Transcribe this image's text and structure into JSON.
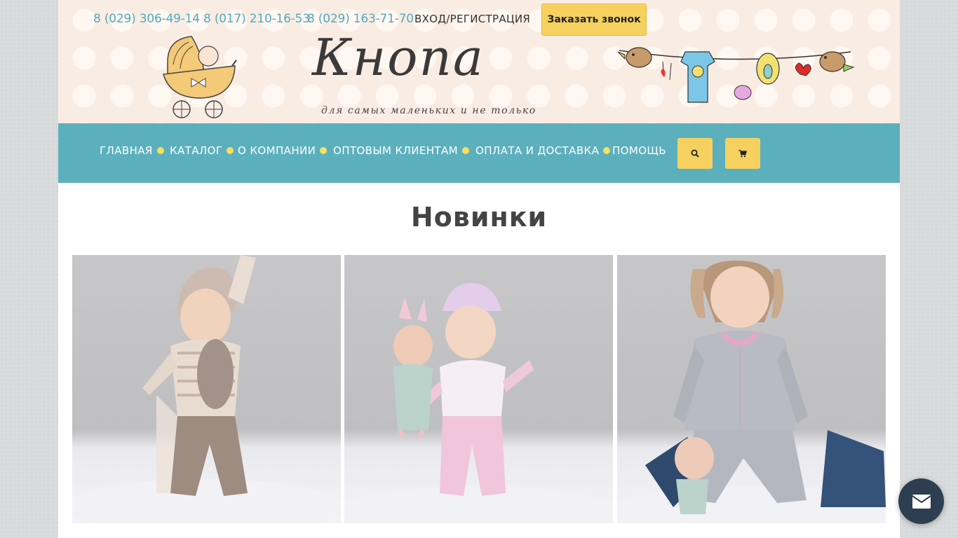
{
  "header": {
    "phones": [
      "8 (029) 306-49-14",
      "8 (017) 210-16-53",
      "8 (029) 163-71-70"
    ],
    "login_label": "ВХОД/РЕГИСТРАЦИЯ",
    "callback_label": "Заказать звонок",
    "logo_text": "Кнопа",
    "logo_tagline": "для самых маленьких и не только"
  },
  "nav": {
    "items": [
      "ГЛАВНАЯ",
      "КАТАЛОГ",
      "О КОМПАНИИ",
      "ОПТОВЫМ КЛИЕНТАМ",
      "ОПЛАТА И ДОСТАВКА",
      "ПОМОЩЬ"
    ],
    "search_icon": "search-icon",
    "cart_icon": "cart-icon"
  },
  "main": {
    "section_title": "Новинки",
    "products": [
      {
        "image": "toddler-striped-outfit-photo"
      },
      {
        "image": "girl-with-doll-pink-outfit-photo"
      },
      {
        "image": "girl-grey-tracksuit-photo"
      }
    ]
  },
  "chat": {
    "icon": "mail-icon"
  },
  "colors": {
    "nav_bg": "#5cb0bd",
    "accent_yellow": "#f6d160",
    "phone_color": "#54a9bd",
    "header_bg": "#f9ece3",
    "chat_bg": "#2c3e50"
  }
}
